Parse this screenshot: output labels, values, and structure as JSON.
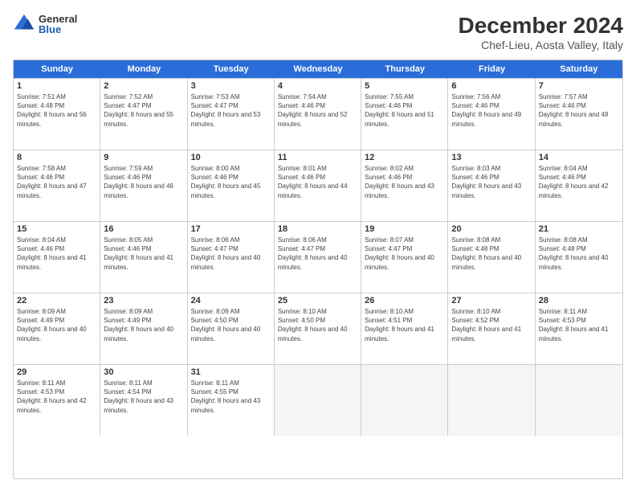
{
  "header": {
    "logo_general": "General",
    "logo_blue": "Blue",
    "title": "December 2024",
    "subtitle": "Chef-Lieu, Aosta Valley, Italy"
  },
  "calendar": {
    "days_of_week": [
      "Sunday",
      "Monday",
      "Tuesday",
      "Wednesday",
      "Thursday",
      "Friday",
      "Saturday"
    ],
    "rows": [
      [
        {
          "day": "1",
          "sunrise": "7:51 AM",
          "sunset": "4:48 PM",
          "daylight": "8 hours and 56 minutes."
        },
        {
          "day": "2",
          "sunrise": "7:52 AM",
          "sunset": "4:47 PM",
          "daylight": "8 hours and 55 minutes."
        },
        {
          "day": "3",
          "sunrise": "7:53 AM",
          "sunset": "4:47 PM",
          "daylight": "8 hours and 53 minutes."
        },
        {
          "day": "4",
          "sunrise": "7:54 AM",
          "sunset": "4:46 PM",
          "daylight": "8 hours and 52 minutes."
        },
        {
          "day": "5",
          "sunrise": "7:55 AM",
          "sunset": "4:46 PM",
          "daylight": "8 hours and 51 minutes."
        },
        {
          "day": "6",
          "sunrise": "7:56 AM",
          "sunset": "4:46 PM",
          "daylight": "8 hours and 49 minutes."
        },
        {
          "day": "7",
          "sunrise": "7:57 AM",
          "sunset": "4:46 PM",
          "daylight": "8 hours and 48 minutes."
        }
      ],
      [
        {
          "day": "8",
          "sunrise": "7:58 AM",
          "sunset": "4:46 PM",
          "daylight": "8 hours and 47 minutes."
        },
        {
          "day": "9",
          "sunrise": "7:59 AM",
          "sunset": "4:46 PM",
          "daylight": "8 hours and 46 minutes."
        },
        {
          "day": "10",
          "sunrise": "8:00 AM",
          "sunset": "4:46 PM",
          "daylight": "8 hours and 45 minutes."
        },
        {
          "day": "11",
          "sunrise": "8:01 AM",
          "sunset": "4:46 PM",
          "daylight": "8 hours and 44 minutes."
        },
        {
          "day": "12",
          "sunrise": "8:02 AM",
          "sunset": "4:46 PM",
          "daylight": "8 hours and 43 minutes."
        },
        {
          "day": "13",
          "sunrise": "8:03 AM",
          "sunset": "4:46 PM",
          "daylight": "8 hours and 43 minutes."
        },
        {
          "day": "14",
          "sunrise": "8:04 AM",
          "sunset": "4:46 PM",
          "daylight": "8 hours and 42 minutes."
        }
      ],
      [
        {
          "day": "15",
          "sunrise": "8:04 AM",
          "sunset": "4:46 PM",
          "daylight": "8 hours and 41 minutes."
        },
        {
          "day": "16",
          "sunrise": "8:05 AM",
          "sunset": "4:46 PM",
          "daylight": "8 hours and 41 minutes."
        },
        {
          "day": "17",
          "sunrise": "8:06 AM",
          "sunset": "4:47 PM",
          "daylight": "8 hours and 40 minutes."
        },
        {
          "day": "18",
          "sunrise": "8:06 AM",
          "sunset": "4:47 PM",
          "daylight": "8 hours and 40 minutes."
        },
        {
          "day": "19",
          "sunrise": "8:07 AM",
          "sunset": "4:47 PM",
          "daylight": "8 hours and 40 minutes."
        },
        {
          "day": "20",
          "sunrise": "8:08 AM",
          "sunset": "4:48 PM",
          "daylight": "8 hours and 40 minutes."
        },
        {
          "day": "21",
          "sunrise": "8:08 AM",
          "sunset": "4:48 PM",
          "daylight": "8 hours and 40 minutes."
        }
      ],
      [
        {
          "day": "22",
          "sunrise": "8:09 AM",
          "sunset": "4:49 PM",
          "daylight": "8 hours and 40 minutes."
        },
        {
          "day": "23",
          "sunrise": "8:09 AM",
          "sunset": "4:49 PM",
          "daylight": "8 hours and 40 minutes."
        },
        {
          "day": "24",
          "sunrise": "8:09 AM",
          "sunset": "4:50 PM",
          "daylight": "8 hours and 40 minutes."
        },
        {
          "day": "25",
          "sunrise": "8:10 AM",
          "sunset": "4:50 PM",
          "daylight": "8 hours and 40 minutes."
        },
        {
          "day": "26",
          "sunrise": "8:10 AM",
          "sunset": "4:51 PM",
          "daylight": "8 hours and 41 minutes."
        },
        {
          "day": "27",
          "sunrise": "8:10 AM",
          "sunset": "4:52 PM",
          "daylight": "8 hours and 41 minutes."
        },
        {
          "day": "28",
          "sunrise": "8:11 AM",
          "sunset": "4:53 PM",
          "daylight": "8 hours and 41 minutes."
        }
      ],
      [
        {
          "day": "29",
          "sunrise": "8:11 AM",
          "sunset": "4:53 PM",
          "daylight": "8 hours and 42 minutes."
        },
        {
          "day": "30",
          "sunrise": "8:11 AM",
          "sunset": "4:54 PM",
          "daylight": "8 hours and 43 minutes."
        },
        {
          "day": "31",
          "sunrise": "8:11 AM",
          "sunset": "4:55 PM",
          "daylight": "8 hours and 43 minutes."
        },
        null,
        null,
        null,
        null
      ]
    ]
  }
}
